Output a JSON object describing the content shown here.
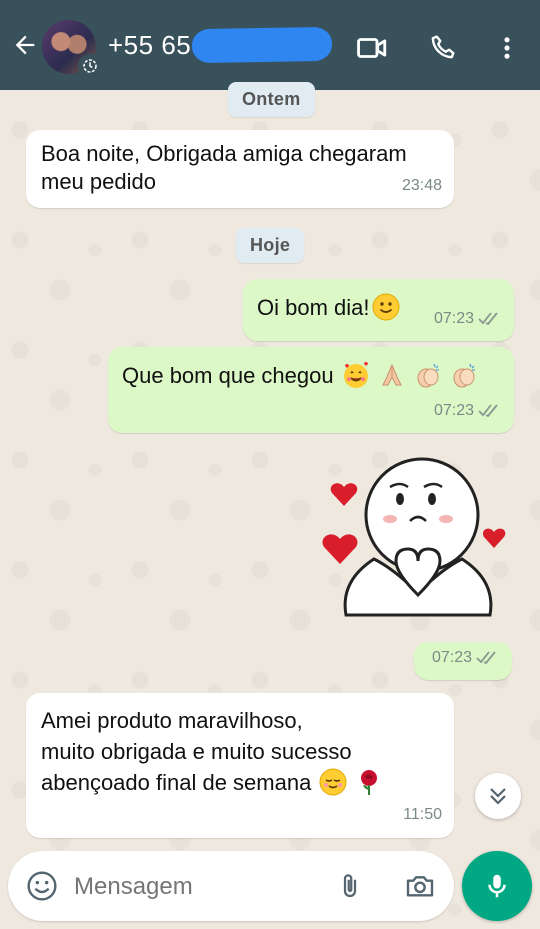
{
  "header": {
    "contact_name": "+55 65",
    "back_icon": "arrow-left-icon",
    "video_icon": "video-call-icon",
    "call_icon": "phone-icon",
    "menu_icon": "more-vert-icon",
    "bg_color": "#38515b"
  },
  "chat": {
    "day_labels": [
      "Ontem",
      "Hoje"
    ],
    "messages": [
      {
        "direction": "in",
        "text": "Boa noite, Obrigada amiga chegaram meu pedido",
        "time": "23:48"
      },
      {
        "direction": "out",
        "text": "Oi bom dia!",
        "emojis": [
          "slightly-smiling-face"
        ],
        "time": "07:23",
        "status": "read"
      },
      {
        "direction": "out",
        "text": "Que bom que chegou",
        "emojis": [
          "smiling-face-with-hearts",
          "folded-hands",
          "clapping-hands",
          "clapping-hands"
        ],
        "time": "07:23",
        "status": "read"
      },
      {
        "direction": "out",
        "type": "sticker",
        "sticker": "heart-hands-character",
        "time": "07:23",
        "status": "read"
      },
      {
        "direction": "in",
        "lines": [
          "Amei produto maravilhoso,",
          "muito obrigada e muito sucesso",
          "abençoado final de semana"
        ],
        "emojis": [
          "relieved-face",
          "rose"
        ],
        "time": "11:50"
      }
    ],
    "incoming_color": "#ffffff",
    "outgoing_color": "#dcf8c6"
  },
  "composer": {
    "placeholder": "Mensagem",
    "emoji_icon": "emoji-icon",
    "attach_icon": "paperclip-icon",
    "camera_icon": "camera-icon",
    "mic_icon": "microphone-icon",
    "accent": "#00a884"
  },
  "scroll_down_icon": "double-chevron-down-icon"
}
